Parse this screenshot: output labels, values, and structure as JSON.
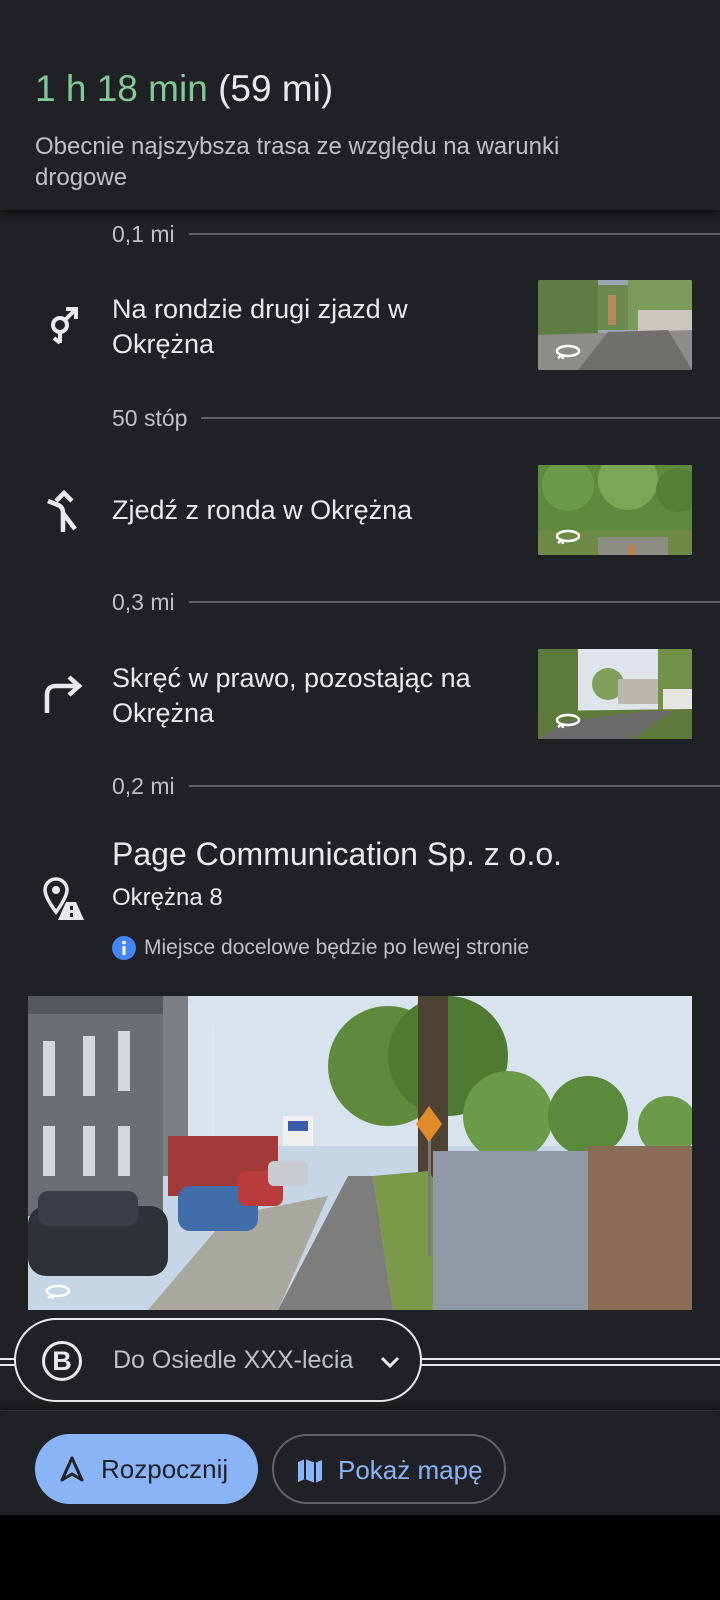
{
  "header": {
    "duration": "1 h 18 min",
    "distance": "(59 mi)",
    "subtitle": "Obecnie najszybsza trasa ze względu na warunki drogowe"
  },
  "steps": [
    {
      "distance": "0,1 mi",
      "instruction": "Na rondzie drugi zjazd w Okrężna",
      "icon": "roundabout-second-exit-icon"
    },
    {
      "distance": "50 stóp",
      "instruction": "Zjedź z ronda w Okrężna",
      "icon": "exit-roundabout-icon"
    },
    {
      "distance": "0,3 mi",
      "instruction": "Skręć w prawo, pozostając na Okrężna",
      "icon": "turn-right-icon"
    }
  ],
  "final_distance": "0,2 mi",
  "destination": {
    "name": "Page Communication Sp. z o.o.",
    "address": "Okrężna 8",
    "note": "Miejsce docelowe będzie po lewej stronie"
  },
  "destination_chip": {
    "badge": "B",
    "label": "Do Osiedle XXX-lecia"
  },
  "actions": {
    "start_label": "Rozpocznij",
    "map_label": "Pokaż mapę"
  },
  "colors": {
    "background": "#202124",
    "duration_green": "#81c995",
    "accent_blue": "#8ab4f8",
    "info_blue": "#4285f4"
  }
}
